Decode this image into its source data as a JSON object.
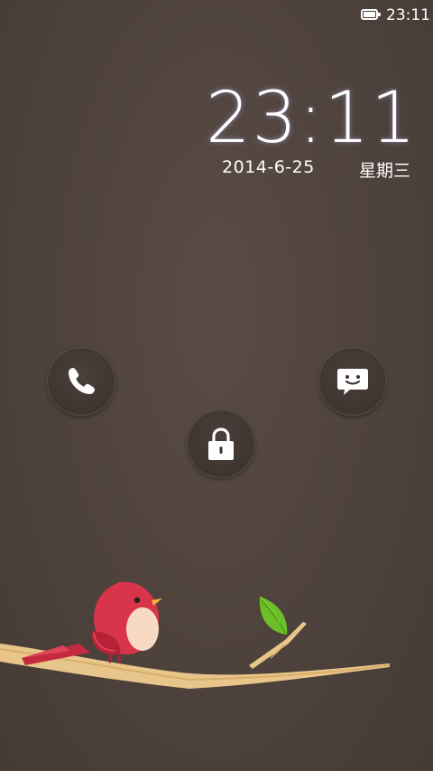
{
  "status_bar": {
    "time": "23:11",
    "battery_level": 1.0
  },
  "clock": {
    "time": "23:11",
    "date": "2014-6-25",
    "weekday": "星期三"
  },
  "shortcuts": {
    "left_icon": "phone-icon",
    "right_icon": "message-icon",
    "center_icon": "lock-icon"
  },
  "colors": {
    "background": "#4d413b",
    "bird": "#d9354a",
    "leaf": "#6dbf2a",
    "branch": "#e8c58a"
  }
}
